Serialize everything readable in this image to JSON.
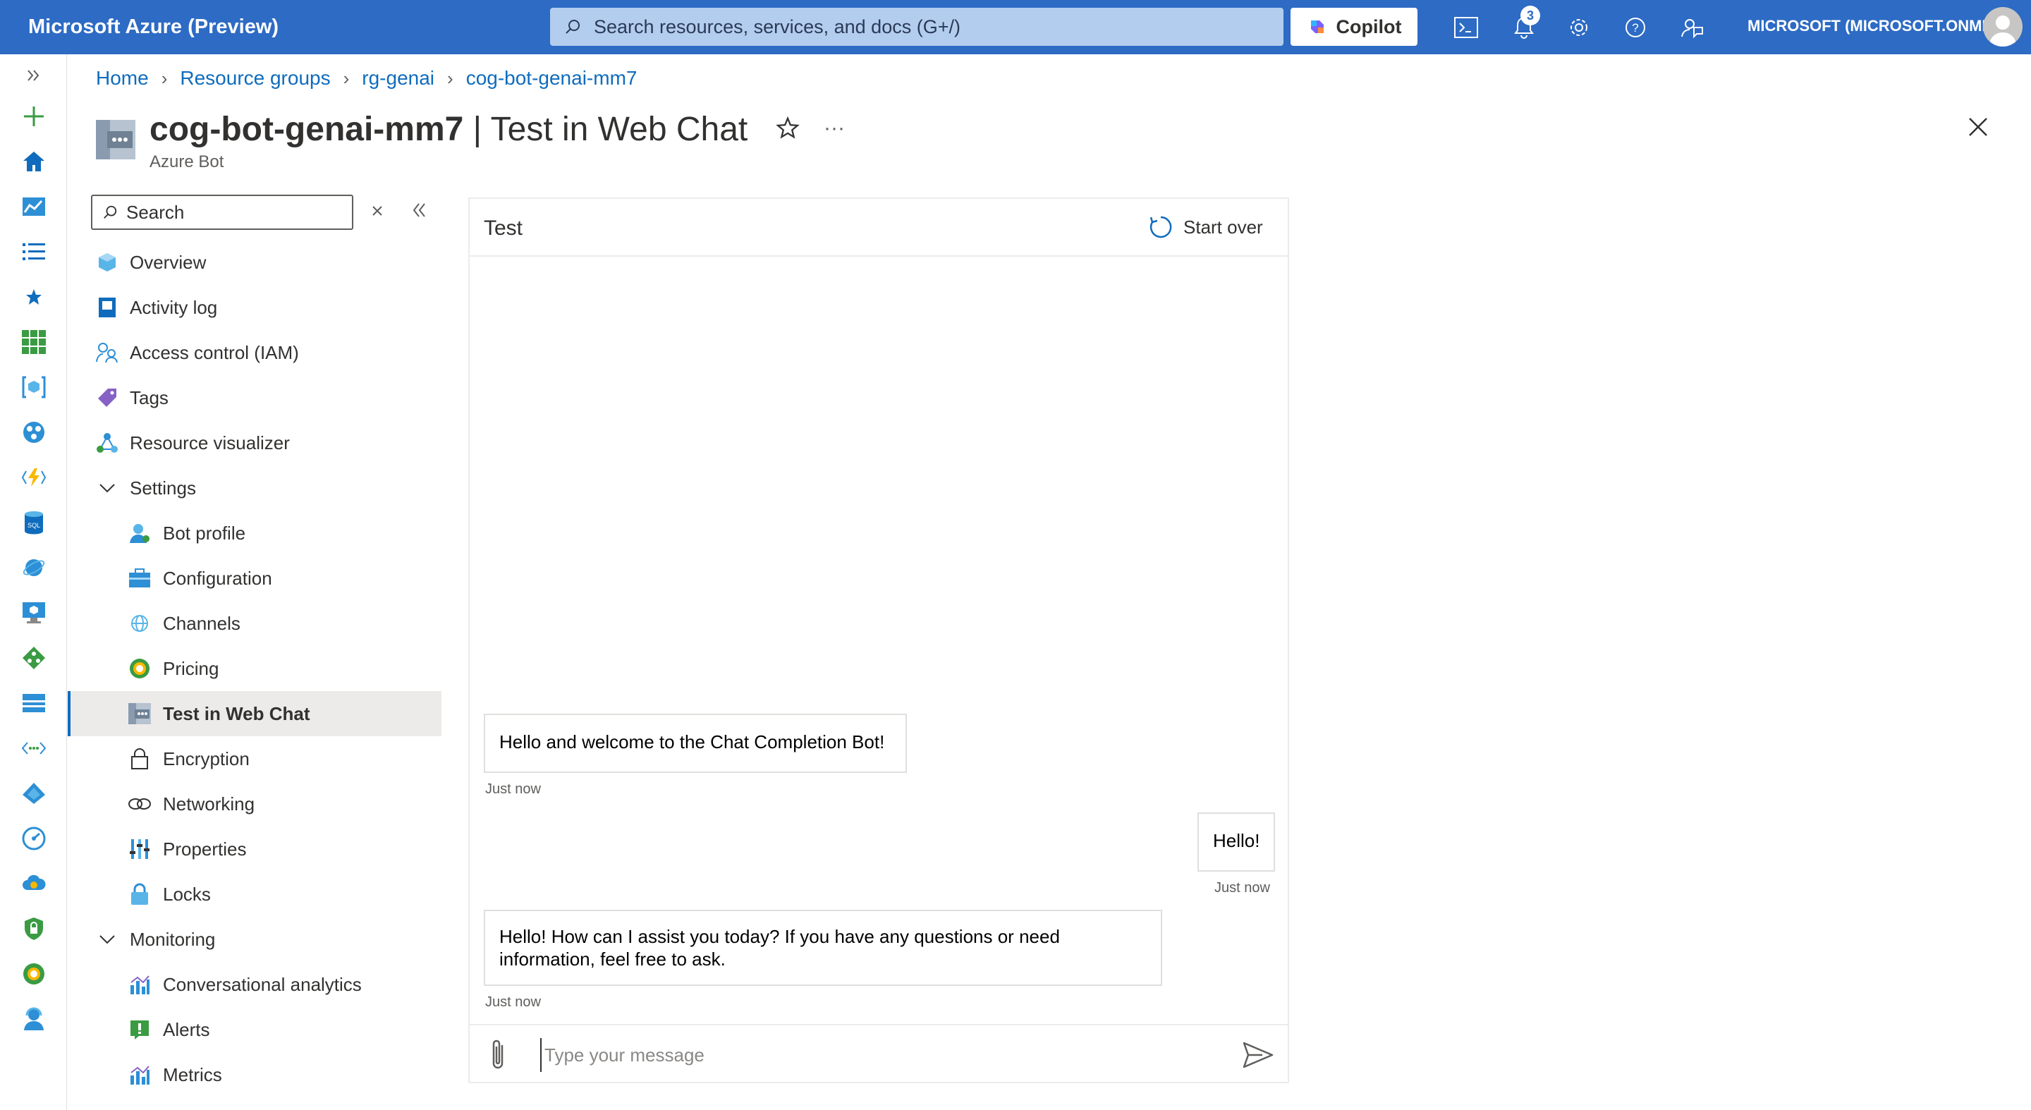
{
  "topbar": {
    "brand": "Microsoft Azure (Preview)",
    "search_placeholder": "Search resources, services, and docs (G+/)",
    "copilot_label": "Copilot",
    "notification_count": "3",
    "account": "MICROSOFT (MICROSOFT.ONMI...",
    "icons": [
      "cloud-shell-icon",
      "notifications-icon",
      "settings-icon",
      "help-icon",
      "feedback-icon"
    ]
  },
  "breadcrumb": [
    "Home",
    "Resource groups",
    "rg-genai",
    "cog-bot-genai-mm7"
  ],
  "header": {
    "resource_name": "cog-bot-genai-mm7",
    "blade_title": " | Test in Web Chat",
    "subtitle": "Azure Bot"
  },
  "menu": {
    "search_placeholder": "Search",
    "items": [
      {
        "label": "Overview",
        "icon": "overview-icon",
        "level": 0
      },
      {
        "label": "Activity log",
        "icon": "activity-log-icon",
        "level": 0
      },
      {
        "label": "Access control (IAM)",
        "icon": "iam-icon",
        "level": 0
      },
      {
        "label": "Tags",
        "icon": "tag-icon",
        "level": 0
      },
      {
        "label": "Resource visualizer",
        "icon": "visualizer-icon",
        "level": 0
      },
      {
        "label": "Settings",
        "icon": "chevron-down-icon",
        "level": 0,
        "group": true
      },
      {
        "label": "Bot profile",
        "icon": "bot-profile-icon",
        "level": 1
      },
      {
        "label": "Configuration",
        "icon": "configuration-icon",
        "level": 1
      },
      {
        "label": "Channels",
        "icon": "channels-icon",
        "level": 1
      },
      {
        "label": "Pricing",
        "icon": "pricing-icon",
        "level": 1
      },
      {
        "label": "Test in Web Chat",
        "icon": "web-chat-icon",
        "level": 1,
        "active": true
      },
      {
        "label": "Encryption",
        "icon": "lock-icon",
        "level": 1
      },
      {
        "label": "Networking",
        "icon": "networking-icon",
        "level": 1
      },
      {
        "label": "Properties",
        "icon": "properties-icon",
        "level": 1
      },
      {
        "label": "Locks",
        "icon": "locks-icon",
        "level": 1
      },
      {
        "label": "Monitoring",
        "icon": "chevron-down-icon",
        "level": 0,
        "group": true
      },
      {
        "label": "Conversational analytics",
        "icon": "analytics-icon",
        "level": 1
      },
      {
        "label": "Alerts",
        "icon": "alerts-icon",
        "level": 1
      },
      {
        "label": "Metrics",
        "icon": "metrics-icon",
        "level": 1
      }
    ]
  },
  "chat": {
    "title": "Test",
    "start_over": "Start over",
    "messages": [
      {
        "from": "bot",
        "text": "Hello and welcome to the Chat Completion Bot!",
        "time": "Just now"
      },
      {
        "from": "user",
        "text": "Hello!",
        "time": "Just now"
      },
      {
        "from": "bot",
        "text": "Hello! How can I assist you today? If you have any questions or need information, feel free to ask.",
        "time": "Just now"
      }
    ],
    "input_placeholder": "Type your message"
  },
  "colors": {
    "topbar": "#2d6bc4",
    "link": "#0f6cbd",
    "active_bg": "#edebe9"
  }
}
